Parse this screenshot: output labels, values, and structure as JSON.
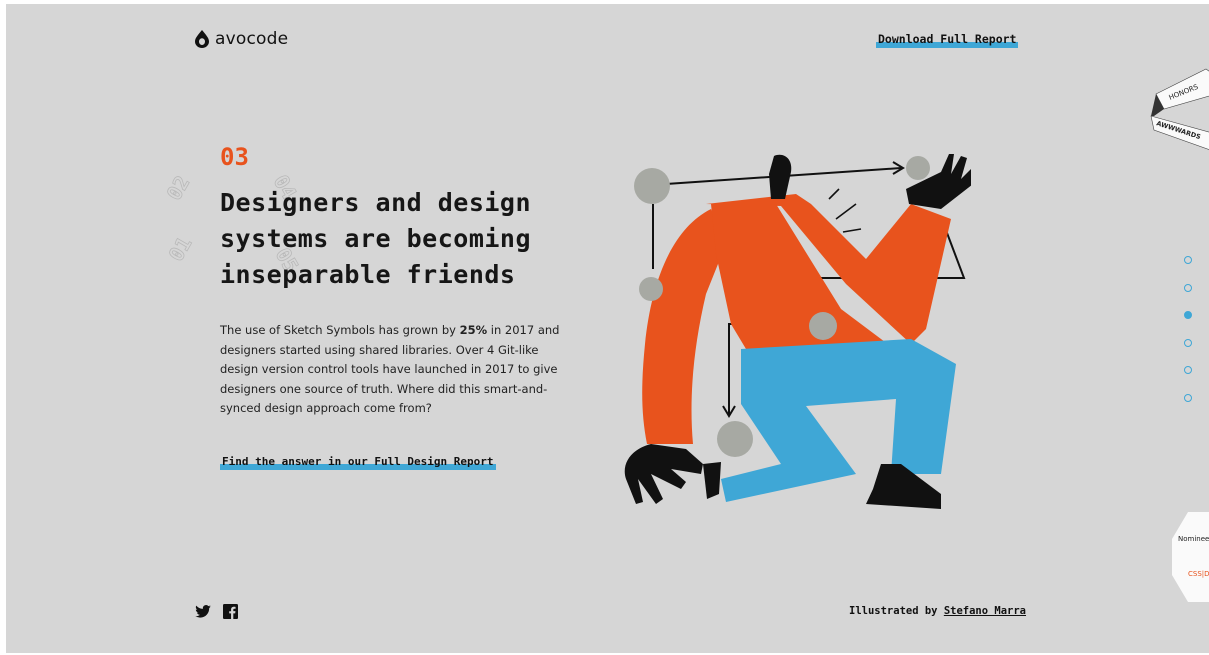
{
  "brand": {
    "name": "avocode"
  },
  "header": {
    "download_label": "Download Full Report"
  },
  "section": {
    "number": "03",
    "headline_lines": [
      "Designers and design",
      "systems are becoming",
      "inseparable friends"
    ],
    "body_prefix": "The use of Sketch Symbols has grown by ",
    "body_bold": "25%",
    "body_suffix": " in 2017 and designers started using shared libraries. Over 4 Git-like design version control tools have launched in 2017 to give designers one source of truth. Where did this smart-and-synced design approach come from?",
    "cta_label": "Find the answer in our Full Design Report"
  },
  "ghost_numbers": [
    "02",
    "01",
    "04",
    "05"
  ],
  "pagination": {
    "count": 6,
    "active_index": 2
  },
  "badges": {
    "honors": "HONORS",
    "awwwards": "AWWWARDS",
    "nominee": "Nominee",
    "nominee_logo": "CSS|D"
  },
  "footer": {
    "credit_prefix": "Illustrated by ",
    "credit_name": "Stefano Marra",
    "social": [
      "twitter-icon",
      "facebook-icon"
    ]
  },
  "colors": {
    "accent": "#3fa7d6",
    "orange": "#e8531d",
    "background": "#d6d6d6",
    "text": "#161616"
  }
}
